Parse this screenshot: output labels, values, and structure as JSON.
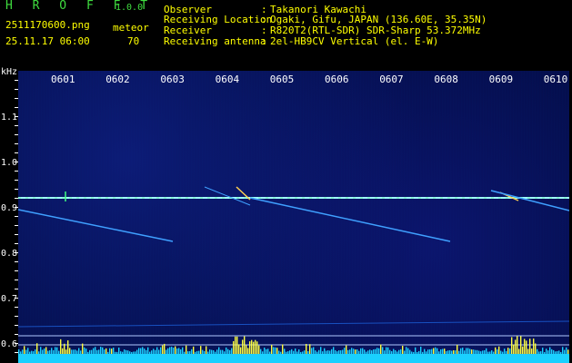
{
  "header": {
    "app_title": "H R O F F T",
    "version": "1.0.0",
    "filename": "2511170600.png",
    "datetime": "25.11.17 06:00",
    "meteor_label": "meteor",
    "meteor_count": "70"
  },
  "info": [
    {
      "key": "Observer",
      "value": "Takanori Kawachi"
    },
    {
      "key": "Receiving Location",
      "value": "Ogaki, Gifu, JAPAN (136.60E, 35.35N)"
    },
    {
      "key": "Receiver",
      "value": "R820T2(RTL-SDR) SDR-Sharp 53.372MHz"
    },
    {
      "key": "Receiving antenna",
      "value": "2el-HB9CV Vertical (el. E-W)"
    }
  ],
  "axis": {
    "unit": "kHz",
    "time_labels": [
      "0601",
      "0602",
      "0603",
      "0604",
      "0605",
      "0606",
      "0607",
      "0608",
      "0609",
      "0610"
    ],
    "freq_labels": [
      "1.1",
      "1.0",
      "0.9",
      "0.8",
      "0.7",
      "0.6"
    ]
  },
  "colors": {
    "background": "#000000",
    "title": "#3fdc3f",
    "text": "#ffff00",
    "carrier": "#a0ffff",
    "trace": "#3fa0ff",
    "noise": "#1ad0ff",
    "spikes": "#ffff40"
  }
}
